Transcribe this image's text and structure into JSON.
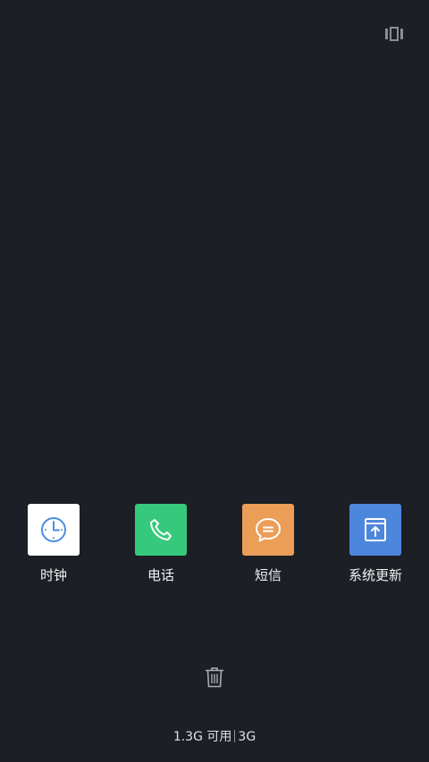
{
  "top_right": {
    "icon": "multi-window-icon"
  },
  "apps": [
    {
      "label": "时钟",
      "icon": "clock-icon",
      "bg_color": "#ffffff",
      "icon_color": "#4a8fe0"
    },
    {
      "label": "电话",
      "icon": "phone-icon",
      "bg_color": "#36c97c",
      "icon_color": "#ffffff"
    },
    {
      "label": "短信",
      "icon": "message-icon",
      "bg_color": "#ec9d58",
      "icon_color": "#ffffff"
    },
    {
      "label": "系统更新",
      "icon": "system-update-icon",
      "bg_color": "#4d86dd",
      "icon_color": "#ffffff"
    }
  ],
  "clear_button": {
    "icon": "trash-icon"
  },
  "memory": {
    "available": "1.3G 可用",
    "total": "3G"
  }
}
